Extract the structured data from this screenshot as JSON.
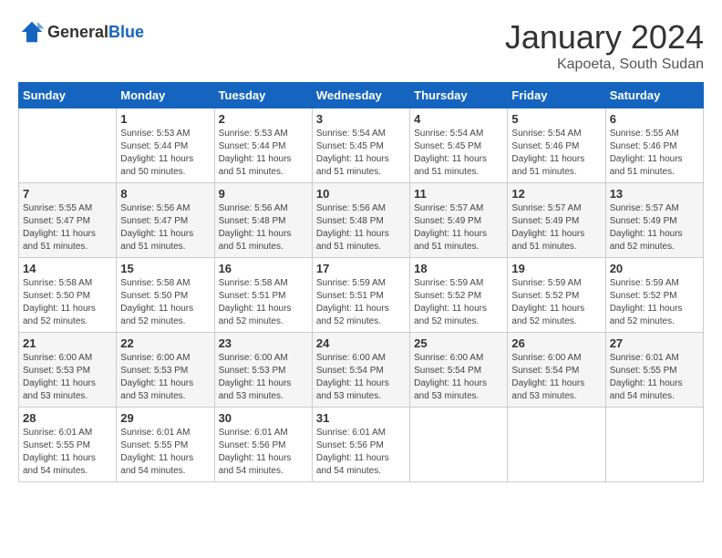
{
  "header": {
    "logo_general": "General",
    "logo_blue": "Blue",
    "month": "January 2024",
    "location": "Kapoeta, South Sudan"
  },
  "weekdays": [
    "Sunday",
    "Monday",
    "Tuesday",
    "Wednesday",
    "Thursday",
    "Friday",
    "Saturday"
  ],
  "weeks": [
    [
      {
        "day": "",
        "sunrise": "",
        "sunset": "",
        "daylight": ""
      },
      {
        "day": "1",
        "sunrise": "Sunrise: 5:53 AM",
        "sunset": "Sunset: 5:44 PM",
        "daylight": "Daylight: 11 hours and 50 minutes."
      },
      {
        "day": "2",
        "sunrise": "Sunrise: 5:53 AM",
        "sunset": "Sunset: 5:44 PM",
        "daylight": "Daylight: 11 hours and 51 minutes."
      },
      {
        "day": "3",
        "sunrise": "Sunrise: 5:54 AM",
        "sunset": "Sunset: 5:45 PM",
        "daylight": "Daylight: 11 hours and 51 minutes."
      },
      {
        "day": "4",
        "sunrise": "Sunrise: 5:54 AM",
        "sunset": "Sunset: 5:45 PM",
        "daylight": "Daylight: 11 hours and 51 minutes."
      },
      {
        "day": "5",
        "sunrise": "Sunrise: 5:54 AM",
        "sunset": "Sunset: 5:46 PM",
        "daylight": "Daylight: 11 hours and 51 minutes."
      },
      {
        "day": "6",
        "sunrise": "Sunrise: 5:55 AM",
        "sunset": "Sunset: 5:46 PM",
        "daylight": "Daylight: 11 hours and 51 minutes."
      }
    ],
    [
      {
        "day": "7",
        "sunrise": "Sunrise: 5:55 AM",
        "sunset": "Sunset: 5:47 PM",
        "daylight": "Daylight: 11 hours and 51 minutes."
      },
      {
        "day": "8",
        "sunrise": "Sunrise: 5:56 AM",
        "sunset": "Sunset: 5:47 PM",
        "daylight": "Daylight: 11 hours and 51 minutes."
      },
      {
        "day": "9",
        "sunrise": "Sunrise: 5:56 AM",
        "sunset": "Sunset: 5:48 PM",
        "daylight": "Daylight: 11 hours and 51 minutes."
      },
      {
        "day": "10",
        "sunrise": "Sunrise: 5:56 AM",
        "sunset": "Sunset: 5:48 PM",
        "daylight": "Daylight: 11 hours and 51 minutes."
      },
      {
        "day": "11",
        "sunrise": "Sunrise: 5:57 AM",
        "sunset": "Sunset: 5:49 PM",
        "daylight": "Daylight: 11 hours and 51 minutes."
      },
      {
        "day": "12",
        "sunrise": "Sunrise: 5:57 AM",
        "sunset": "Sunset: 5:49 PM",
        "daylight": "Daylight: 11 hours and 51 minutes."
      },
      {
        "day": "13",
        "sunrise": "Sunrise: 5:57 AM",
        "sunset": "Sunset: 5:49 PM",
        "daylight": "Daylight: 11 hours and 52 minutes."
      }
    ],
    [
      {
        "day": "14",
        "sunrise": "Sunrise: 5:58 AM",
        "sunset": "Sunset: 5:50 PM",
        "daylight": "Daylight: 11 hours and 52 minutes."
      },
      {
        "day": "15",
        "sunrise": "Sunrise: 5:58 AM",
        "sunset": "Sunset: 5:50 PM",
        "daylight": "Daylight: 11 hours and 52 minutes."
      },
      {
        "day": "16",
        "sunrise": "Sunrise: 5:58 AM",
        "sunset": "Sunset: 5:51 PM",
        "daylight": "Daylight: 11 hours and 52 minutes."
      },
      {
        "day": "17",
        "sunrise": "Sunrise: 5:59 AM",
        "sunset": "Sunset: 5:51 PM",
        "daylight": "Daylight: 11 hours and 52 minutes."
      },
      {
        "day": "18",
        "sunrise": "Sunrise: 5:59 AM",
        "sunset": "Sunset: 5:52 PM",
        "daylight": "Daylight: 11 hours and 52 minutes."
      },
      {
        "day": "19",
        "sunrise": "Sunrise: 5:59 AM",
        "sunset": "Sunset: 5:52 PM",
        "daylight": "Daylight: 11 hours and 52 minutes."
      },
      {
        "day": "20",
        "sunrise": "Sunrise: 5:59 AM",
        "sunset": "Sunset: 5:52 PM",
        "daylight": "Daylight: 11 hours and 52 minutes."
      }
    ],
    [
      {
        "day": "21",
        "sunrise": "Sunrise: 6:00 AM",
        "sunset": "Sunset: 5:53 PM",
        "daylight": "Daylight: 11 hours and 53 minutes."
      },
      {
        "day": "22",
        "sunrise": "Sunrise: 6:00 AM",
        "sunset": "Sunset: 5:53 PM",
        "daylight": "Daylight: 11 hours and 53 minutes."
      },
      {
        "day": "23",
        "sunrise": "Sunrise: 6:00 AM",
        "sunset": "Sunset: 5:53 PM",
        "daylight": "Daylight: 11 hours and 53 minutes."
      },
      {
        "day": "24",
        "sunrise": "Sunrise: 6:00 AM",
        "sunset": "Sunset: 5:54 PM",
        "daylight": "Daylight: 11 hours and 53 minutes."
      },
      {
        "day": "25",
        "sunrise": "Sunrise: 6:00 AM",
        "sunset": "Sunset: 5:54 PM",
        "daylight": "Daylight: 11 hours and 53 minutes."
      },
      {
        "day": "26",
        "sunrise": "Sunrise: 6:00 AM",
        "sunset": "Sunset: 5:54 PM",
        "daylight": "Daylight: 11 hours and 53 minutes."
      },
      {
        "day": "27",
        "sunrise": "Sunrise: 6:01 AM",
        "sunset": "Sunset: 5:55 PM",
        "daylight": "Daylight: 11 hours and 54 minutes."
      }
    ],
    [
      {
        "day": "28",
        "sunrise": "Sunrise: 6:01 AM",
        "sunset": "Sunset: 5:55 PM",
        "daylight": "Daylight: 11 hours and 54 minutes."
      },
      {
        "day": "29",
        "sunrise": "Sunrise: 6:01 AM",
        "sunset": "Sunset: 5:55 PM",
        "daylight": "Daylight: 11 hours and 54 minutes."
      },
      {
        "day": "30",
        "sunrise": "Sunrise: 6:01 AM",
        "sunset": "Sunset: 5:56 PM",
        "daylight": "Daylight: 11 hours and 54 minutes."
      },
      {
        "day": "31",
        "sunrise": "Sunrise: 6:01 AM",
        "sunset": "Sunset: 5:56 PM",
        "daylight": "Daylight: 11 hours and 54 minutes."
      },
      {
        "day": "",
        "sunrise": "",
        "sunset": "",
        "daylight": ""
      },
      {
        "day": "",
        "sunrise": "",
        "sunset": "",
        "daylight": ""
      },
      {
        "day": "",
        "sunrise": "",
        "sunset": "",
        "daylight": ""
      }
    ]
  ]
}
